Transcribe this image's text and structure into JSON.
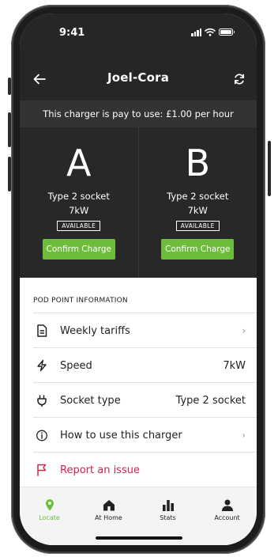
{
  "status_bar": {
    "time": "9:41"
  },
  "header": {
    "title": "Joel-Cora"
  },
  "notice": "This charger is pay to use: £1.00 per hour",
  "sockets": [
    {
      "letter": "A",
      "type": "Type 2 socket",
      "power": "7kW",
      "status": "AVAILABLE",
      "action": "Confirm Charge"
    },
    {
      "letter": "B",
      "type": "Type 2 socket",
      "power": "7kW",
      "status": "AVAILABLE",
      "action": "Confirm Charge"
    }
  ],
  "info": {
    "heading": "POD POINT INFORMATION",
    "rows": [
      {
        "label": "Weekly tariffs",
        "icon": "document-icon"
      },
      {
        "label": "Speed",
        "value": "7kW",
        "icon": "lightning-icon"
      },
      {
        "label": "Socket type",
        "value": "Type 2 socket",
        "icon": "plug-icon"
      },
      {
        "label": "How to use this charger",
        "icon": "info-icon"
      },
      {
        "label": "Report an issue",
        "icon": "flag-icon"
      }
    ]
  },
  "tabs": [
    {
      "label": "Locate",
      "icon": "location-pin-icon",
      "active": true
    },
    {
      "label": "At Home",
      "icon": "home-icon"
    },
    {
      "label": "Stats",
      "icon": "bar-chart-icon"
    },
    {
      "label": "Account",
      "icon": "person-icon"
    }
  ],
  "colors": {
    "accent": "#6dbd3a",
    "danger": "#d4214a",
    "dark": "#262626"
  }
}
